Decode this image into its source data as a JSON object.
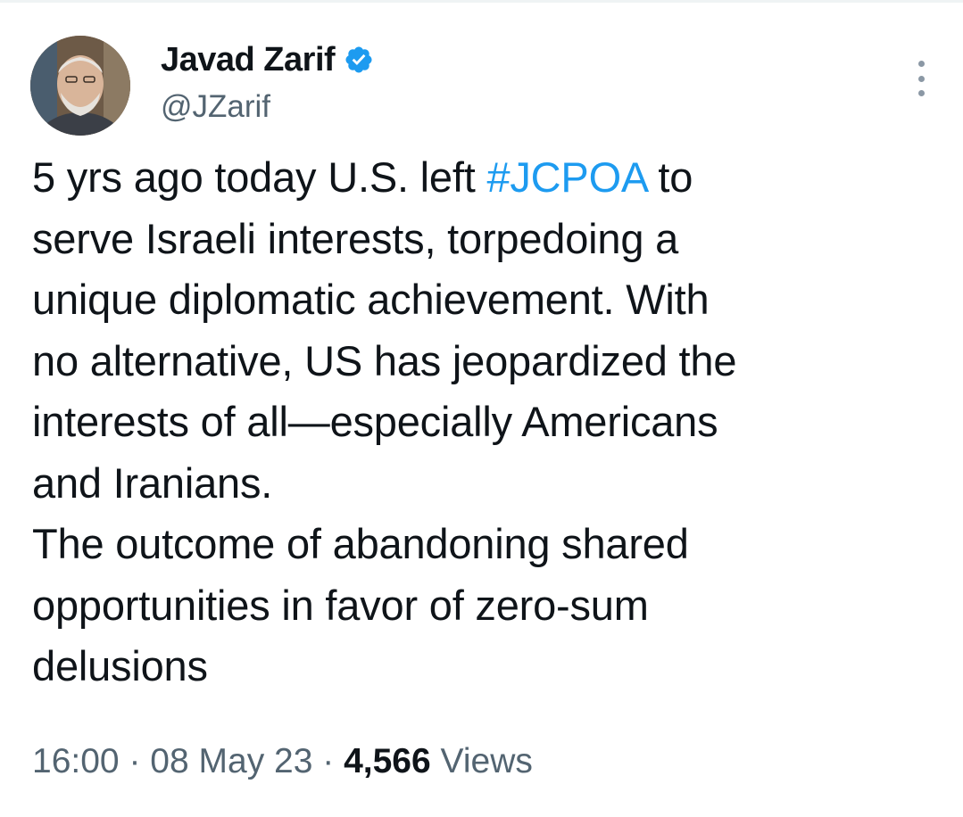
{
  "author": {
    "display_name": "Javad Zarif",
    "handle": "@JZarif",
    "verified": true,
    "avatar_icon": "profile-photo"
  },
  "tweet": {
    "line1_before": "5 yrs ago today U.S. left ",
    "hashtag": "#JCPOA",
    "line1_after": " to\nserve Israeli interests, torpedoing a\nunique diplomatic achievement. With\nno alternative, US has jeopardized the\ninterests of all—especially Americans\nand Iranians.\nThe outcome of abandoning shared\nopportunities in favor of zero-sum\ndelusions"
  },
  "meta": {
    "time": "16:00",
    "separator": "·",
    "date": "08 May 23",
    "views_count": "4,566",
    "views_label": "Views"
  },
  "colors": {
    "text": "#0f1419",
    "secondary": "#536471",
    "accent": "#1d9bf0"
  }
}
